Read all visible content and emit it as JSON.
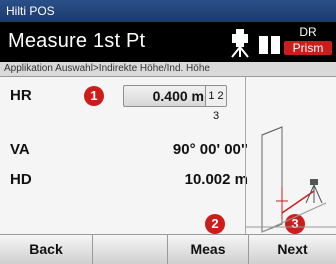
{
  "app_title": "Hilti POS",
  "header": {
    "title": "Measure 1st Pt",
    "mode_top": "DR",
    "mode_bottom": "Prism"
  },
  "breadcrumb": "Applikation Auswahl>Indirekte Höhe/Ind. Höhe",
  "fields": {
    "hr": {
      "label": "HR",
      "value": "0.400 m",
      "input_mode": "1 2 3"
    },
    "va": {
      "label": "VA",
      "value": "90° 00' 00\""
    },
    "hd": {
      "label": "HD",
      "value": "10.002 m"
    }
  },
  "callouts": {
    "one": "1",
    "two": "2",
    "three": "3"
  },
  "softkeys": {
    "back": "Back",
    "blank1": "",
    "meas": "Meas",
    "next": "Next"
  }
}
